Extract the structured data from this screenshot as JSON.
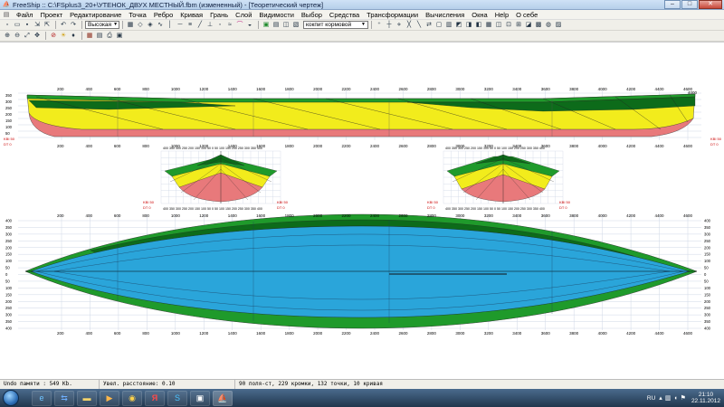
{
  "window": {
    "title": "FreeShip ::  C:\\FSplus3_20+\\УТЕНОК_ДВУХ МЕСТНЫЙ.fbm (измененный) - [Теоретический чертеж]",
    "minimize_icon": "minimize-icon",
    "maximize_icon": "maximize-icon",
    "close_icon": "close-icon"
  },
  "menu": {
    "items": [
      "Файл",
      "Проект",
      "Редактирование",
      "Точка",
      "Ребро",
      "Кривая",
      "Грань",
      "Слой",
      "Видимости",
      "Выбор",
      "Средства",
      "Трансформации",
      "Вычисления",
      "Окна",
      "Help",
      "О себе"
    ]
  },
  "toolbar": {
    "precision_select": "Высокая",
    "layer_select": "кокпит кормовой",
    "colors": {
      "hull_yellow": "#f2ec1c",
      "hull_green": "#1f9a2b",
      "hull_dark_green": "#0d6b1a",
      "hull_pink": "#e8797b",
      "deck_blue": "#2aa5da",
      "grid_blue": "#cfd7e6",
      "accent_red": "#cc0000"
    }
  },
  "drawing": {
    "profile_x_ticks": [
      "200",
      "400",
      "600",
      "800",
      "1000",
      "1200",
      "1400",
      "1600",
      "1800",
      "2000",
      "2200",
      "2400",
      "2600",
      "2800",
      "3000",
      "3200",
      "3400",
      "3600",
      "3800",
      "4000",
      "4200",
      "4400",
      "4600"
    ],
    "profile_y_ticks": [
      "350",
      "300",
      "250",
      "200",
      "150",
      "100",
      "50"
    ],
    "profile_top_right_label": "4000",
    "plan_y_ticks": [
      "400",
      "350",
      "300",
      "250",
      "200",
      "150",
      "100",
      "50",
      "0",
      "50",
      "100",
      "150",
      "200",
      "250",
      "300",
      "350",
      "400"
    ],
    "section_ticks": "400 350 300 250 200 150 100  50  0  50 100 150 200 250 300 350 400",
    "red_label_left": "KBI 50",
    "red_label_left2": "DT 0",
    "red_label_right": "KBI 50",
    "red_label_right2": "DT 0"
  },
  "status": {
    "undo": "Undo памяти : 549 Kb.",
    "zoom": "Увел. расстояние: 0.10",
    "counts": "90 поля-ст, 229 кромки, 132 точки, 10 кривая"
  },
  "taskbar": {
    "language": "RU",
    "time": "21:10",
    "date": "22.11.2012",
    "apps": [
      "ie-icon",
      "teamviewer-icon",
      "explorer-icon",
      "media-icon",
      "browser-icon",
      "yandex-icon",
      "skype-icon",
      "terminal-icon",
      "freeship-icon"
    ]
  }
}
